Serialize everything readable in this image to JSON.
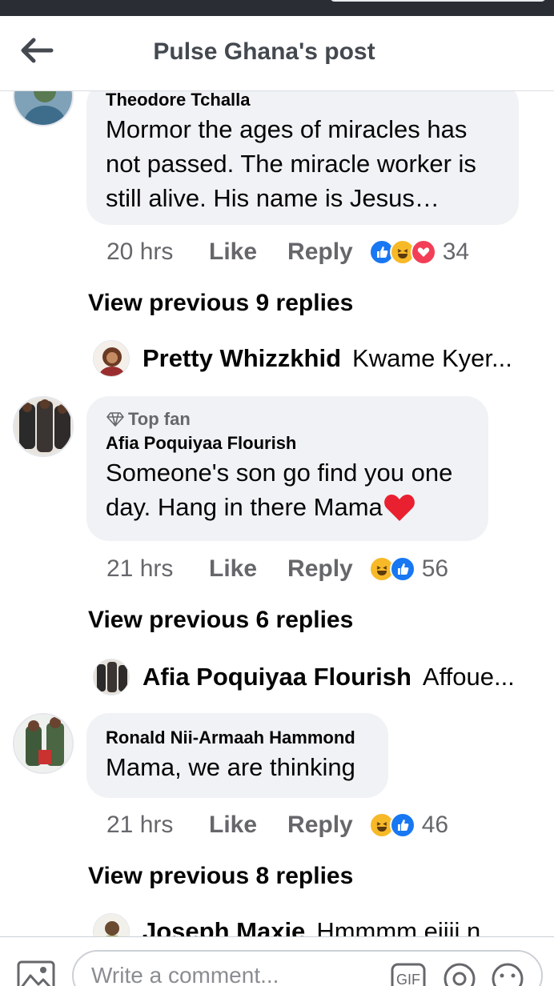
{
  "header": {
    "title": "Pulse Ghana's post"
  },
  "comments": [
    {
      "author": "Theodore Tchalla",
      "text_lines": [
        "Mormor the ages of miracles has",
        "not passed. The miracle worker is",
        "still alive. His name is Jesus…"
      ],
      "time": "20 hrs",
      "like": "Like",
      "reply": "Reply",
      "reactions": [
        "like-icon",
        "haha-icon",
        "love-icon"
      ],
      "reaction_count": "34",
      "view_previous": "View previous 9 replies",
      "last_reply": {
        "author": "Pretty Whizzkhid",
        "text": "Kwame Kyer..."
      }
    },
    {
      "badge": "Top fan",
      "author": "Afia Poquiyaa Flourish",
      "text_lines": [
        "Someone's son go find you one",
        "day. Hang in there Mama"
      ],
      "time": "21 hrs",
      "like": "Like",
      "reply": "Reply",
      "reactions": [
        "haha-icon",
        "like-icon"
      ],
      "reaction_count": "56",
      "view_previous": "View previous 6 replies",
      "last_reply": {
        "author": "Afia Poquiyaa Flourish",
        "text": "Affoue..."
      }
    },
    {
      "author": "Ronald Nii-Armaah Hammond",
      "text_lines": [
        "Mama, we are thinking"
      ],
      "time": "21 hrs",
      "like": "Like",
      "reply": "Reply",
      "reactions": [
        "haha-icon",
        "like-icon"
      ],
      "reaction_count": "46",
      "view_previous": "View previous 8 replies",
      "last_reply": {
        "author": "Joseph Maxie",
        "text": "Hmmmm eiiii n"
      }
    }
  ],
  "composer": {
    "placeholder": "Write a comment...",
    "gif_label": "GIF"
  },
  "colors": {
    "like": "#1877f2",
    "love": "#f33e58",
    "haha": "#f7b928",
    "bubble": "#f0f2f5"
  }
}
